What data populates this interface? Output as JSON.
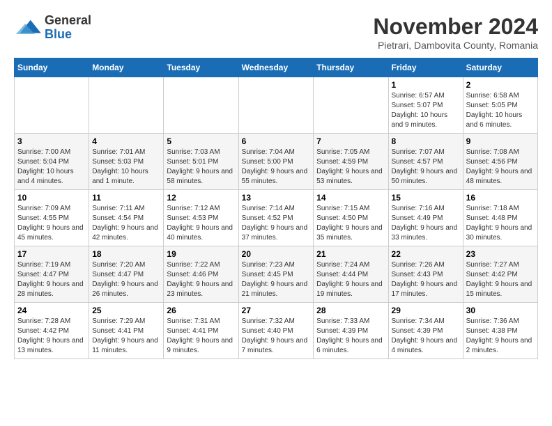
{
  "logo": {
    "general": "General",
    "blue": "Blue"
  },
  "header": {
    "month": "November 2024",
    "location": "Pietrari, Dambovita County, Romania"
  },
  "weekdays": [
    "Sunday",
    "Monday",
    "Tuesday",
    "Wednesday",
    "Thursday",
    "Friday",
    "Saturday"
  ],
  "weeks": [
    [
      {
        "day": "",
        "info": ""
      },
      {
        "day": "",
        "info": ""
      },
      {
        "day": "",
        "info": ""
      },
      {
        "day": "",
        "info": ""
      },
      {
        "day": "",
        "info": ""
      },
      {
        "day": "1",
        "info": "Sunrise: 6:57 AM\nSunset: 5:07 PM\nDaylight: 10 hours and 9 minutes."
      },
      {
        "day": "2",
        "info": "Sunrise: 6:58 AM\nSunset: 5:05 PM\nDaylight: 10 hours and 6 minutes."
      }
    ],
    [
      {
        "day": "3",
        "info": "Sunrise: 7:00 AM\nSunset: 5:04 PM\nDaylight: 10 hours and 4 minutes."
      },
      {
        "day": "4",
        "info": "Sunrise: 7:01 AM\nSunset: 5:03 PM\nDaylight: 10 hours and 1 minute."
      },
      {
        "day": "5",
        "info": "Sunrise: 7:03 AM\nSunset: 5:01 PM\nDaylight: 9 hours and 58 minutes."
      },
      {
        "day": "6",
        "info": "Sunrise: 7:04 AM\nSunset: 5:00 PM\nDaylight: 9 hours and 55 minutes."
      },
      {
        "day": "7",
        "info": "Sunrise: 7:05 AM\nSunset: 4:59 PM\nDaylight: 9 hours and 53 minutes."
      },
      {
        "day": "8",
        "info": "Sunrise: 7:07 AM\nSunset: 4:57 PM\nDaylight: 9 hours and 50 minutes."
      },
      {
        "day": "9",
        "info": "Sunrise: 7:08 AM\nSunset: 4:56 PM\nDaylight: 9 hours and 48 minutes."
      }
    ],
    [
      {
        "day": "10",
        "info": "Sunrise: 7:09 AM\nSunset: 4:55 PM\nDaylight: 9 hours and 45 minutes."
      },
      {
        "day": "11",
        "info": "Sunrise: 7:11 AM\nSunset: 4:54 PM\nDaylight: 9 hours and 42 minutes."
      },
      {
        "day": "12",
        "info": "Sunrise: 7:12 AM\nSunset: 4:53 PM\nDaylight: 9 hours and 40 minutes."
      },
      {
        "day": "13",
        "info": "Sunrise: 7:14 AM\nSunset: 4:52 PM\nDaylight: 9 hours and 37 minutes."
      },
      {
        "day": "14",
        "info": "Sunrise: 7:15 AM\nSunset: 4:50 PM\nDaylight: 9 hours and 35 minutes."
      },
      {
        "day": "15",
        "info": "Sunrise: 7:16 AM\nSunset: 4:49 PM\nDaylight: 9 hours and 33 minutes."
      },
      {
        "day": "16",
        "info": "Sunrise: 7:18 AM\nSunset: 4:48 PM\nDaylight: 9 hours and 30 minutes."
      }
    ],
    [
      {
        "day": "17",
        "info": "Sunrise: 7:19 AM\nSunset: 4:47 PM\nDaylight: 9 hours and 28 minutes."
      },
      {
        "day": "18",
        "info": "Sunrise: 7:20 AM\nSunset: 4:47 PM\nDaylight: 9 hours and 26 minutes."
      },
      {
        "day": "19",
        "info": "Sunrise: 7:22 AM\nSunset: 4:46 PM\nDaylight: 9 hours and 23 minutes."
      },
      {
        "day": "20",
        "info": "Sunrise: 7:23 AM\nSunset: 4:45 PM\nDaylight: 9 hours and 21 minutes."
      },
      {
        "day": "21",
        "info": "Sunrise: 7:24 AM\nSunset: 4:44 PM\nDaylight: 9 hours and 19 minutes."
      },
      {
        "day": "22",
        "info": "Sunrise: 7:26 AM\nSunset: 4:43 PM\nDaylight: 9 hours and 17 minutes."
      },
      {
        "day": "23",
        "info": "Sunrise: 7:27 AM\nSunset: 4:42 PM\nDaylight: 9 hours and 15 minutes."
      }
    ],
    [
      {
        "day": "24",
        "info": "Sunrise: 7:28 AM\nSunset: 4:42 PM\nDaylight: 9 hours and 13 minutes."
      },
      {
        "day": "25",
        "info": "Sunrise: 7:29 AM\nSunset: 4:41 PM\nDaylight: 9 hours and 11 minutes."
      },
      {
        "day": "26",
        "info": "Sunrise: 7:31 AM\nSunset: 4:41 PM\nDaylight: 9 hours and 9 minutes."
      },
      {
        "day": "27",
        "info": "Sunrise: 7:32 AM\nSunset: 4:40 PM\nDaylight: 9 hours and 7 minutes."
      },
      {
        "day": "28",
        "info": "Sunrise: 7:33 AM\nSunset: 4:39 PM\nDaylight: 9 hours and 6 minutes."
      },
      {
        "day": "29",
        "info": "Sunrise: 7:34 AM\nSunset: 4:39 PM\nDaylight: 9 hours and 4 minutes."
      },
      {
        "day": "30",
        "info": "Sunrise: 7:36 AM\nSunset: 4:38 PM\nDaylight: 9 hours and 2 minutes."
      }
    ]
  ]
}
